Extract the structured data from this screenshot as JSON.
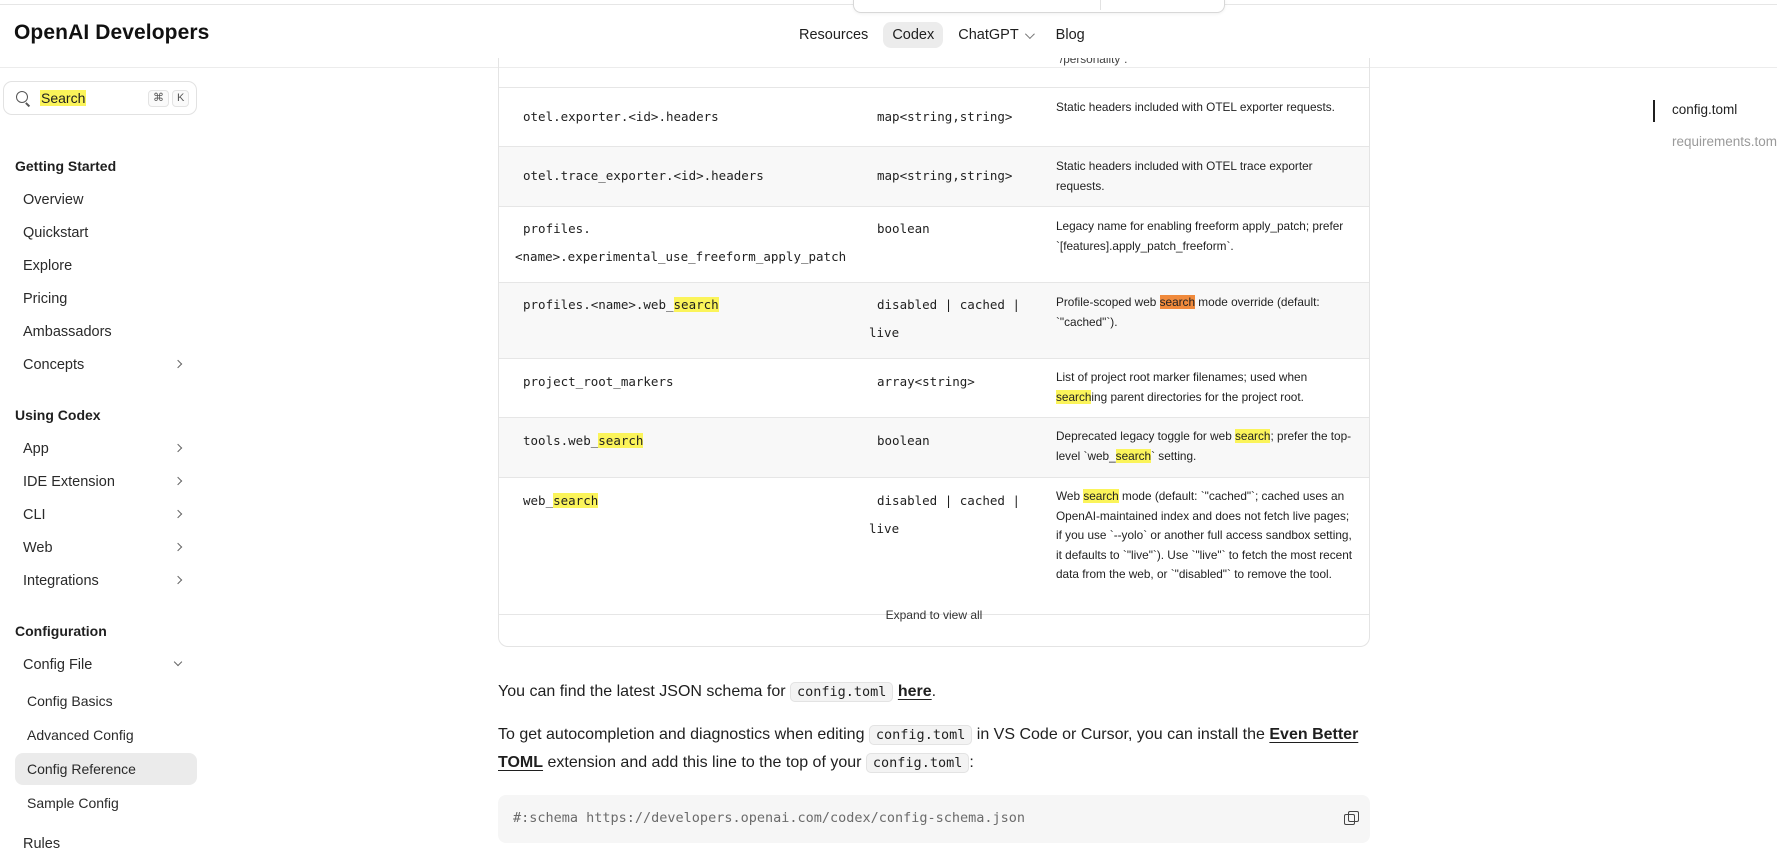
{
  "brand": "OpenAI Developers",
  "topnav": [
    {
      "label": "Resources",
      "active": false
    },
    {
      "label": "Codex",
      "active": true
    },
    {
      "label": "ChatGPT",
      "active": false,
      "dropdown": true
    },
    {
      "label": "Blog",
      "active": false
    }
  ],
  "search": {
    "label": "Search",
    "kbd1": "⌘",
    "kbd2": "K"
  },
  "sidebar": {
    "getting_started": {
      "title": "Getting Started",
      "items": [
        "Overview",
        "Quickstart",
        "Explore",
        "Pricing",
        "Ambassadors",
        "Concepts"
      ]
    },
    "using_codex": {
      "title": "Using Codex",
      "items": [
        "App",
        "IDE Extension",
        "CLI",
        "Web",
        "Integrations"
      ]
    },
    "configuration": {
      "title": "Configuration",
      "config_file": "Config File",
      "sub_items": [
        "Config Basics",
        "Advanced Config",
        "Config Reference",
        "Sample Config"
      ],
      "active": "Config Reference",
      "rules": "Rules"
    }
  },
  "table": {
    "partial_top": "`/personality`.",
    "rows": [
      {
        "key": "otel.exporter.<id>.headers",
        "type": "map<string,string>",
        "desc": "Static headers included with OTEL exporter requests."
      },
      {
        "key": "otel.trace_exporter.<id>.headers",
        "type": "map<string,string>",
        "desc": "Static headers included with OTEL trace exporter requests."
      },
      {
        "key_line1": "profiles.",
        "key_line2": "<name>.experimental_use_freeform_apply_patch",
        "type": "boolean",
        "desc": "Legacy name for enabling freeform apply_patch; prefer `[features].apply_patch_freeform`."
      },
      {
        "key_pre": "profiles.<name>.web_",
        "key_mark": "search",
        "type_line1": "disabled | cached |",
        "type_line2": "live",
        "desc_pre": "Profile-scoped web ",
        "desc_mark": "search",
        "desc_post": " mode override (default: `\"cached\"`)."
      },
      {
        "key": "project_root_markers",
        "type": "array<string>",
        "desc_pre": "List of project root marker filenames; used when ",
        "desc_mark": "search",
        "desc_post": "ing parent directories for the project root."
      },
      {
        "key_pre": "tools.web_",
        "key_mark": "search",
        "type": "boolean",
        "desc_pre": "Deprecated legacy toggle for web ",
        "desc_mark": "search",
        "desc_mid": "; prefer the top-level `web_",
        "desc_mark2": "search",
        "desc_post": "` setting."
      },
      {
        "key_pre": "web_",
        "key_mark": "search",
        "type_line1": "disabled | cached |",
        "type_line2": "live",
        "desc_pre": "Web ",
        "desc_mark": "search",
        "desc_post": " mode (default: `\"cached\"`; cached uses an OpenAI-maintained index and does not fetch live pages; if you use `--yolo` or another full access sandbox setting, it defaults to `\"live\"`). Use `\"live\"` to fetch the most recent data from the web, or `\"disabled\"` to remove the tool."
      }
    ],
    "expand": "Expand to view all"
  },
  "para1": {
    "pre": "You can find the latest JSON schema for ",
    "code": "config.toml",
    "link": "here",
    "post": "."
  },
  "para2": {
    "pre": "To get autocompletion and diagnostics when editing ",
    "code1": "config.toml",
    "mid": " in VS Code or Cursor, you can install the ",
    "link": "Even Better TOML",
    "mid2": " extension and add this line to the top of your ",
    "code2": "config.toml",
    "post": ":"
  },
  "codeblock": "#:schema https://developers.openai.com/codex/config-schema.json",
  "toc": [
    "config.toml",
    "requirements.toml"
  ]
}
